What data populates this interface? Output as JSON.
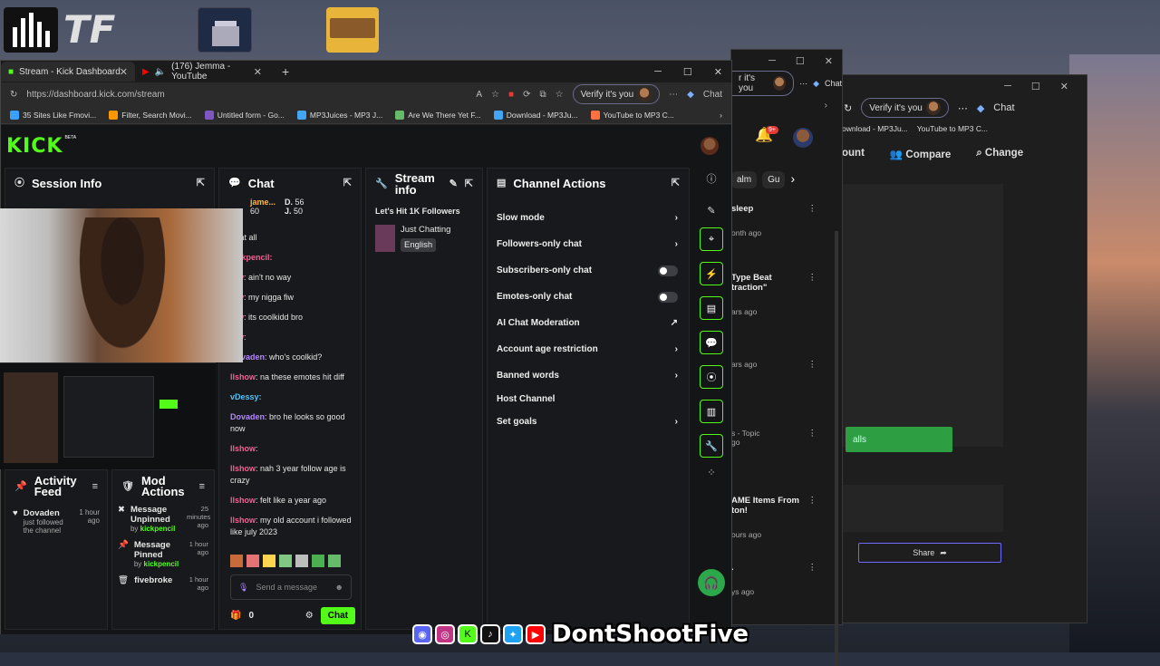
{
  "desktop": {
    "taskbar_logo": "TF",
    "overlay_name": "DontShootFive"
  },
  "right_window": {
    "verify_label": "Verify it's you",
    "chat_label": "Chat",
    "bookmark_1": "ownload - MP3Ju...",
    "bookmark_2": "YouTube to MP3 C...",
    "nav": [
      "ount",
      "Compare",
      "Change"
    ],
    "share_label": "Share"
  },
  "middle_window": {
    "verify_label": "r it's you",
    "chat_label": "Chat",
    "notif_count": "9+",
    "chips": [
      "alm",
      "Gu"
    ],
    "videos": [
      {
        "title": "sleep",
        "meta": "onth ago"
      },
      {
        "title": "Type Beat",
        "title2": "traction\"",
        "meta": "ars ago"
      },
      {
        "title": "",
        "meta": "ars ago"
      },
      {
        "title": "",
        "meta": "s - Topic",
        "meta2": "go"
      },
      {
        "title": "AME Items From",
        "title2": "ton!",
        "meta": "ours ago"
      },
      {
        "title": ".",
        "meta": "ys ago"
      }
    ],
    "green_button": "alls"
  },
  "browser": {
    "tabs": [
      {
        "label": "Stream - Kick Dashboard",
        "active": true
      },
      {
        "label": "(176) Jemma - YouTube",
        "active": false
      }
    ],
    "url": "https://dashboard.kick.com/stream",
    "verify_label": "Verify it's you",
    "chat_label": "Chat",
    "bookmarks": [
      {
        "label": "35 Sites Like Fmovi...",
        "color": "#3aa0ff"
      },
      {
        "label": "Filter, Search Movi...",
        "color": "#ff9800"
      },
      {
        "label": "Untitled form - Go...",
        "color": "#7e57c2"
      },
      {
        "label": "MP3Juices - MP3 J...",
        "color": "#42a5f5"
      },
      {
        "label": "Are We There Yet F...",
        "color": "#66bb6a"
      },
      {
        "label": "Download - MP3Ju...",
        "color": "#42a5f5"
      },
      {
        "label": "YouTube to MP3 C...",
        "color": "#ff7043"
      }
    ]
  },
  "kick": {
    "logo": "KICK",
    "beta": "BETA",
    "session_info": {
      "title": "Session Info"
    },
    "chat": {
      "title": "Chat",
      "leaders": [
        {
          "name": "jame...",
          "score": "60"
        },
        {
          "name": "D.",
          "score": "56"
        },
        {
          "name": "J.",
          "score": "50"
        }
      ],
      "messages": [
        {
          "user": "",
          "text": "er at all"
        },
        {
          "user": "kickpencil:",
          "text": ""
        },
        {
          "user": "low",
          "text": ": ain't no way"
        },
        {
          "user": "low",
          "text": ": my nigga fiw"
        },
        {
          "user": "low",
          "text": ": its coolkidd bro"
        },
        {
          "user": "low",
          "text": ":"
        },
        {
          "user": "Dovaden",
          "text": ": who's coolkid?"
        },
        {
          "user": "llshow",
          "text": ": na these emotes hit diff"
        },
        {
          "user": "vDessy:",
          "text": ""
        },
        {
          "user": "Dovaden",
          "text": ": bro he looks so good now"
        },
        {
          "user": "llshow",
          "text": ":"
        },
        {
          "user": "llshow",
          "text": ": nah 3 year follow age is crazy"
        },
        {
          "user": "llshow",
          "text": ": felt like a year ago"
        },
        {
          "user": "llshow",
          "text": ": my old account i followed like july 2023"
        }
      ],
      "input_placeholder": "Send a message",
      "points": "0",
      "send_label": "Chat"
    },
    "stream_info": {
      "title": "Stream info",
      "stream_title": "Let's Hit 1K Followers",
      "category": "Just Chatting",
      "language": "English"
    },
    "channel_actions": {
      "title": "Channel Actions",
      "items": [
        {
          "label": "Slow mode",
          "control": "chevron"
        },
        {
          "label": "Followers-only chat",
          "control": "chevron"
        },
        {
          "label": "Subscribers-only chat",
          "control": "toggle"
        },
        {
          "label": "Emotes-only chat",
          "control": "toggle"
        },
        {
          "label": "AI Chat Moderation",
          "control": "external"
        },
        {
          "label": "Account age restriction",
          "control": "chevron"
        },
        {
          "label": "Banned words",
          "control": "chevron"
        },
        {
          "label": "Host Channel",
          "control": "none"
        },
        {
          "label": "Set goals",
          "control": "chevron"
        }
      ]
    },
    "activity_feed": {
      "title": "Activity Feed",
      "items": [
        {
          "user": "Dovaden",
          "text": "just followed the channel",
          "time": "1 hour ago"
        }
      ]
    },
    "mod_actions": {
      "title": "Mod Actions",
      "items": [
        {
          "action": "Message Unpinned",
          "by": "by",
          "user": "kickpencil",
          "time": "25 minutes ago"
        },
        {
          "action": "Message Pinned",
          "by": "by",
          "user": "kickpencil",
          "time": "1 hour ago"
        },
        {
          "action": "fivebroke",
          "by": "",
          "user": "",
          "time": "1 hour ago"
        }
      ]
    }
  },
  "colors": {
    "kick_green": "#53fc18",
    "bg": "#141517",
    "panel": "#18191c"
  }
}
